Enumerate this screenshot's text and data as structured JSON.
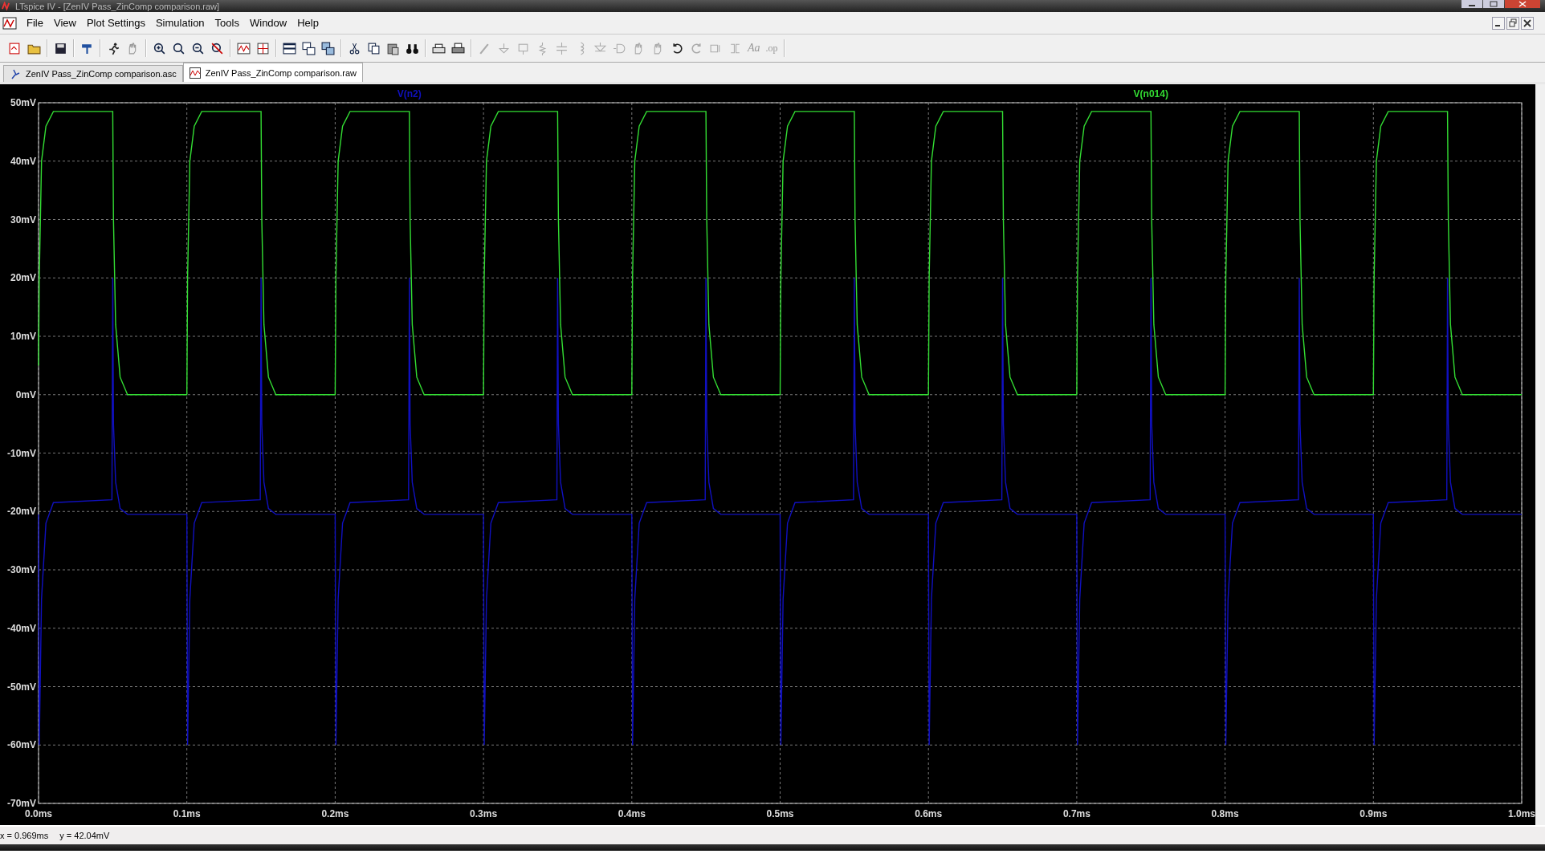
{
  "window": {
    "title": "LTspice IV - [ZenIV Pass_ZinComp comparison.raw]"
  },
  "menu": [
    "File",
    "View",
    "Plot Settings",
    "Simulation",
    "Tools",
    "Window",
    "Help"
  ],
  "toolbar_texts": [
    "Aa",
    ".op"
  ],
  "tabs": [
    {
      "label": "ZenIV Pass_ZinComp comparison.asc",
      "kind": "schematic",
      "selected": false
    },
    {
      "label": "ZenIV Pass_ZinComp comparison.raw",
      "kind": "waveform",
      "selected": true
    }
  ],
  "plot": {
    "chart_data": {
      "type": "line",
      "grid": true,
      "x": [
        0,
        0.0005,
        0.002,
        0.005,
        0.01,
        0.0495,
        0.05,
        0.0505,
        0.052,
        0.055,
        0.06,
        0.1,
        0.1005,
        0.102,
        0.105,
        0.11,
        0.1495,
        0.15,
        0.1505,
        0.152,
        0.155,
        0.16,
        0.2,
        0.2005,
        0.202,
        0.205,
        0.21,
        0.2495,
        0.25,
        0.2505,
        0.252,
        0.255,
        0.26,
        0.3,
        0.3005,
        0.302,
        0.305,
        0.31,
        0.3495,
        0.35,
        0.3505,
        0.352,
        0.355,
        0.36,
        0.4,
        0.4005,
        0.402,
        0.405,
        0.41,
        0.4495,
        0.45,
        0.4505,
        0.452,
        0.455,
        0.46,
        0.5,
        0.5005,
        0.502,
        0.505,
        0.51,
        0.5495,
        0.55,
        0.5505,
        0.552,
        0.555,
        0.56,
        0.6,
        0.6005,
        0.602,
        0.605,
        0.61,
        0.6495,
        0.65,
        0.6505,
        0.652,
        0.655,
        0.66,
        0.7,
        0.7005,
        0.702,
        0.705,
        0.71,
        0.7495,
        0.75,
        0.7505,
        0.752,
        0.755,
        0.76,
        0.8,
        0.8005,
        0.802,
        0.805,
        0.81,
        0.8495,
        0.85,
        0.8505,
        0.852,
        0.855,
        0.86,
        0.9,
        0.9005,
        0.902,
        0.905,
        0.91,
        0.9495,
        0.95,
        0.9505,
        0.952,
        0.955,
        0.96,
        1.0
      ],
      "series": [
        {
          "name": "V(n2)",
          "color": "#1010c0",
          "values": [
            -20.5,
            -60,
            -35,
            -22,
            -18.5,
            -18,
            20,
            -5,
            -15,
            -19.5,
            -20.5,
            -20.5,
            -60,
            -35,
            -22,
            -18.5,
            -18,
            20,
            -5,
            -15,
            -19.5,
            -20.5,
            -20.5,
            -60,
            -35,
            -22,
            -18.5,
            -18,
            20,
            -5,
            -15,
            -19.5,
            -20.5,
            -20.5,
            -60,
            -35,
            -22,
            -18.5,
            -18,
            20,
            -5,
            -15,
            -19.5,
            -20.5,
            -20.5,
            -60,
            -35,
            -22,
            -18.5,
            -18,
            20,
            -5,
            -15,
            -19.5,
            -20.5,
            -20.5,
            -60,
            -35,
            -22,
            -18.5,
            -18,
            20,
            -5,
            -15,
            -19.5,
            -20.5,
            -20.5,
            -60,
            -35,
            -22,
            -18.5,
            -18,
            20,
            -5,
            -15,
            -19.5,
            -20.5,
            -20.5,
            -60,
            -35,
            -22,
            -18.5,
            -18,
            20,
            -5,
            -15,
            -19.5,
            -20.5,
            -20.5,
            -60,
            -35,
            -22,
            -18.5,
            -18,
            20,
            -5,
            -15,
            -19.5,
            -20.5,
            -20.5,
            -60,
            -35,
            -22,
            -18.5,
            -18,
            20,
            -5,
            -15,
            -19.5,
            -20.5,
            -20.5
          ]
        },
        {
          "name": "V(n014)",
          "color": "#33dd33",
          "values": [
            5,
            20,
            40,
            46,
            48.5,
            48.5,
            48.5,
            30,
            12,
            3,
            0,
            0,
            20,
            40,
            46,
            48.5,
            48.5,
            48.5,
            30,
            12,
            3,
            0,
            0,
            20,
            40,
            46,
            48.5,
            48.5,
            48.5,
            30,
            12,
            3,
            0,
            0,
            20,
            40,
            46,
            48.5,
            48.5,
            48.5,
            30,
            12,
            3,
            0,
            0,
            20,
            40,
            46,
            48.5,
            48.5,
            48.5,
            30,
            12,
            3,
            0,
            0,
            20,
            40,
            46,
            48.5,
            48.5,
            48.5,
            30,
            12,
            3,
            0,
            0,
            20,
            40,
            46,
            48.5,
            48.5,
            48.5,
            30,
            12,
            3,
            0,
            0,
            20,
            40,
            46,
            48.5,
            48.5,
            48.5,
            30,
            12,
            3,
            0,
            0,
            20,
            40,
            46,
            48.5,
            48.5,
            48.5,
            30,
            12,
            3,
            0,
            0,
            20,
            40,
            46,
            48.5,
            48.5,
            48.5,
            30,
            12,
            3,
            0,
            0
          ]
        }
      ],
      "xlim": [
        0,
        1.0
      ],
      "ylim": [
        -70,
        50
      ],
      "xticks": [
        {
          "value": 0,
          "label": "0.0ms"
        },
        {
          "value": 0.1,
          "label": "0.1ms"
        },
        {
          "value": 0.2,
          "label": "0.2ms"
        },
        {
          "value": 0.3,
          "label": "0.3ms"
        },
        {
          "value": 0.4,
          "label": "0.4ms"
        },
        {
          "value": 0.5,
          "label": "0.5ms"
        },
        {
          "value": 0.6,
          "label": "0.6ms"
        },
        {
          "value": 0.7,
          "label": "0.7ms"
        },
        {
          "value": 0.8,
          "label": "0.8ms"
        },
        {
          "value": 0.9,
          "label": "0.9ms"
        },
        {
          "value": 1.0,
          "label": "1.0ms"
        }
      ],
      "yticks": [
        {
          "value": 50,
          "label": "50mV"
        },
        {
          "value": 40,
          "label": "40mV"
        },
        {
          "value": 30,
          "label": "30mV"
        },
        {
          "value": 20,
          "label": "20mV"
        },
        {
          "value": 10,
          "label": "10mV"
        },
        {
          "value": 0,
          "label": "0mV"
        },
        {
          "value": -10,
          "label": "-10mV"
        },
        {
          "value": -20,
          "label": "-20mV"
        },
        {
          "value": -30,
          "label": "-30mV"
        },
        {
          "value": -40,
          "label": "-40mV"
        },
        {
          "value": -50,
          "label": "-50mV"
        },
        {
          "value": -60,
          "label": "-60mV"
        },
        {
          "value": -70,
          "label": "-70mV"
        }
      ]
    }
  },
  "status_bar": {
    "cursor_x": "x = 0.969ms",
    "cursor_y": "y = 42.04mV"
  }
}
